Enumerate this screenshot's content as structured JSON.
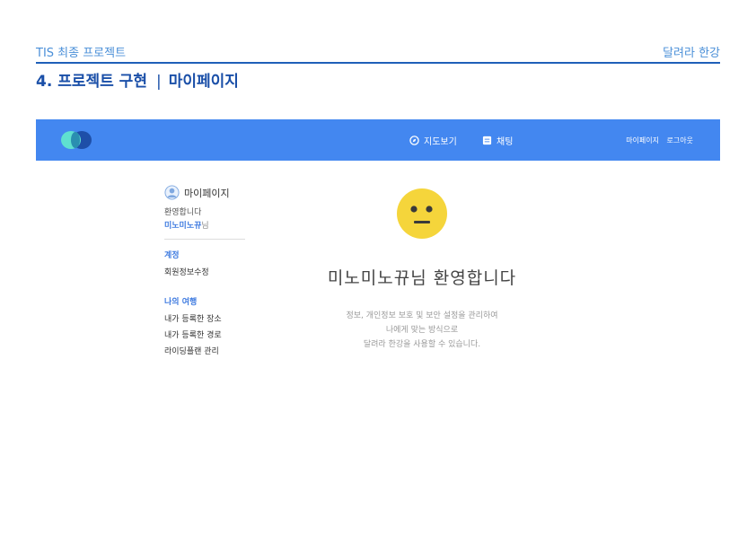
{
  "slide": {
    "header_left": "TIS 최종 프로젝트",
    "header_right": "달려라 한강",
    "title_main": "4. 프로젝트 구현",
    "title_separator": "|",
    "title_sub": "마이페이지"
  },
  "navbar": {
    "map_label": "지도보기",
    "chat_label": "채팅",
    "mypage_label": "마이페이지",
    "logout_label": "로그아웃",
    "bg_color": "#4387f0"
  },
  "sidebar": {
    "title": "마이페이지",
    "welcome": "환영합니다",
    "username": "미노미노뀨",
    "username_suffix": "님",
    "account_section": "계정",
    "account_links": [
      "회원정보수정"
    ],
    "trip_section": "나의 여행",
    "trip_links": [
      "내가 등록한 장소",
      "내가 등록한 경로",
      "라이딩플랜 관리"
    ]
  },
  "main": {
    "welcome_text": "미노미노뀨님 환영합니다",
    "desc_line1": "정보, 개인정보 보호 및 보안 설정을 관리하여",
    "desc_line2": "나에게 맞는 방식으로",
    "desc_line3": "달려라 한강을 사용할 수 있습니다."
  }
}
